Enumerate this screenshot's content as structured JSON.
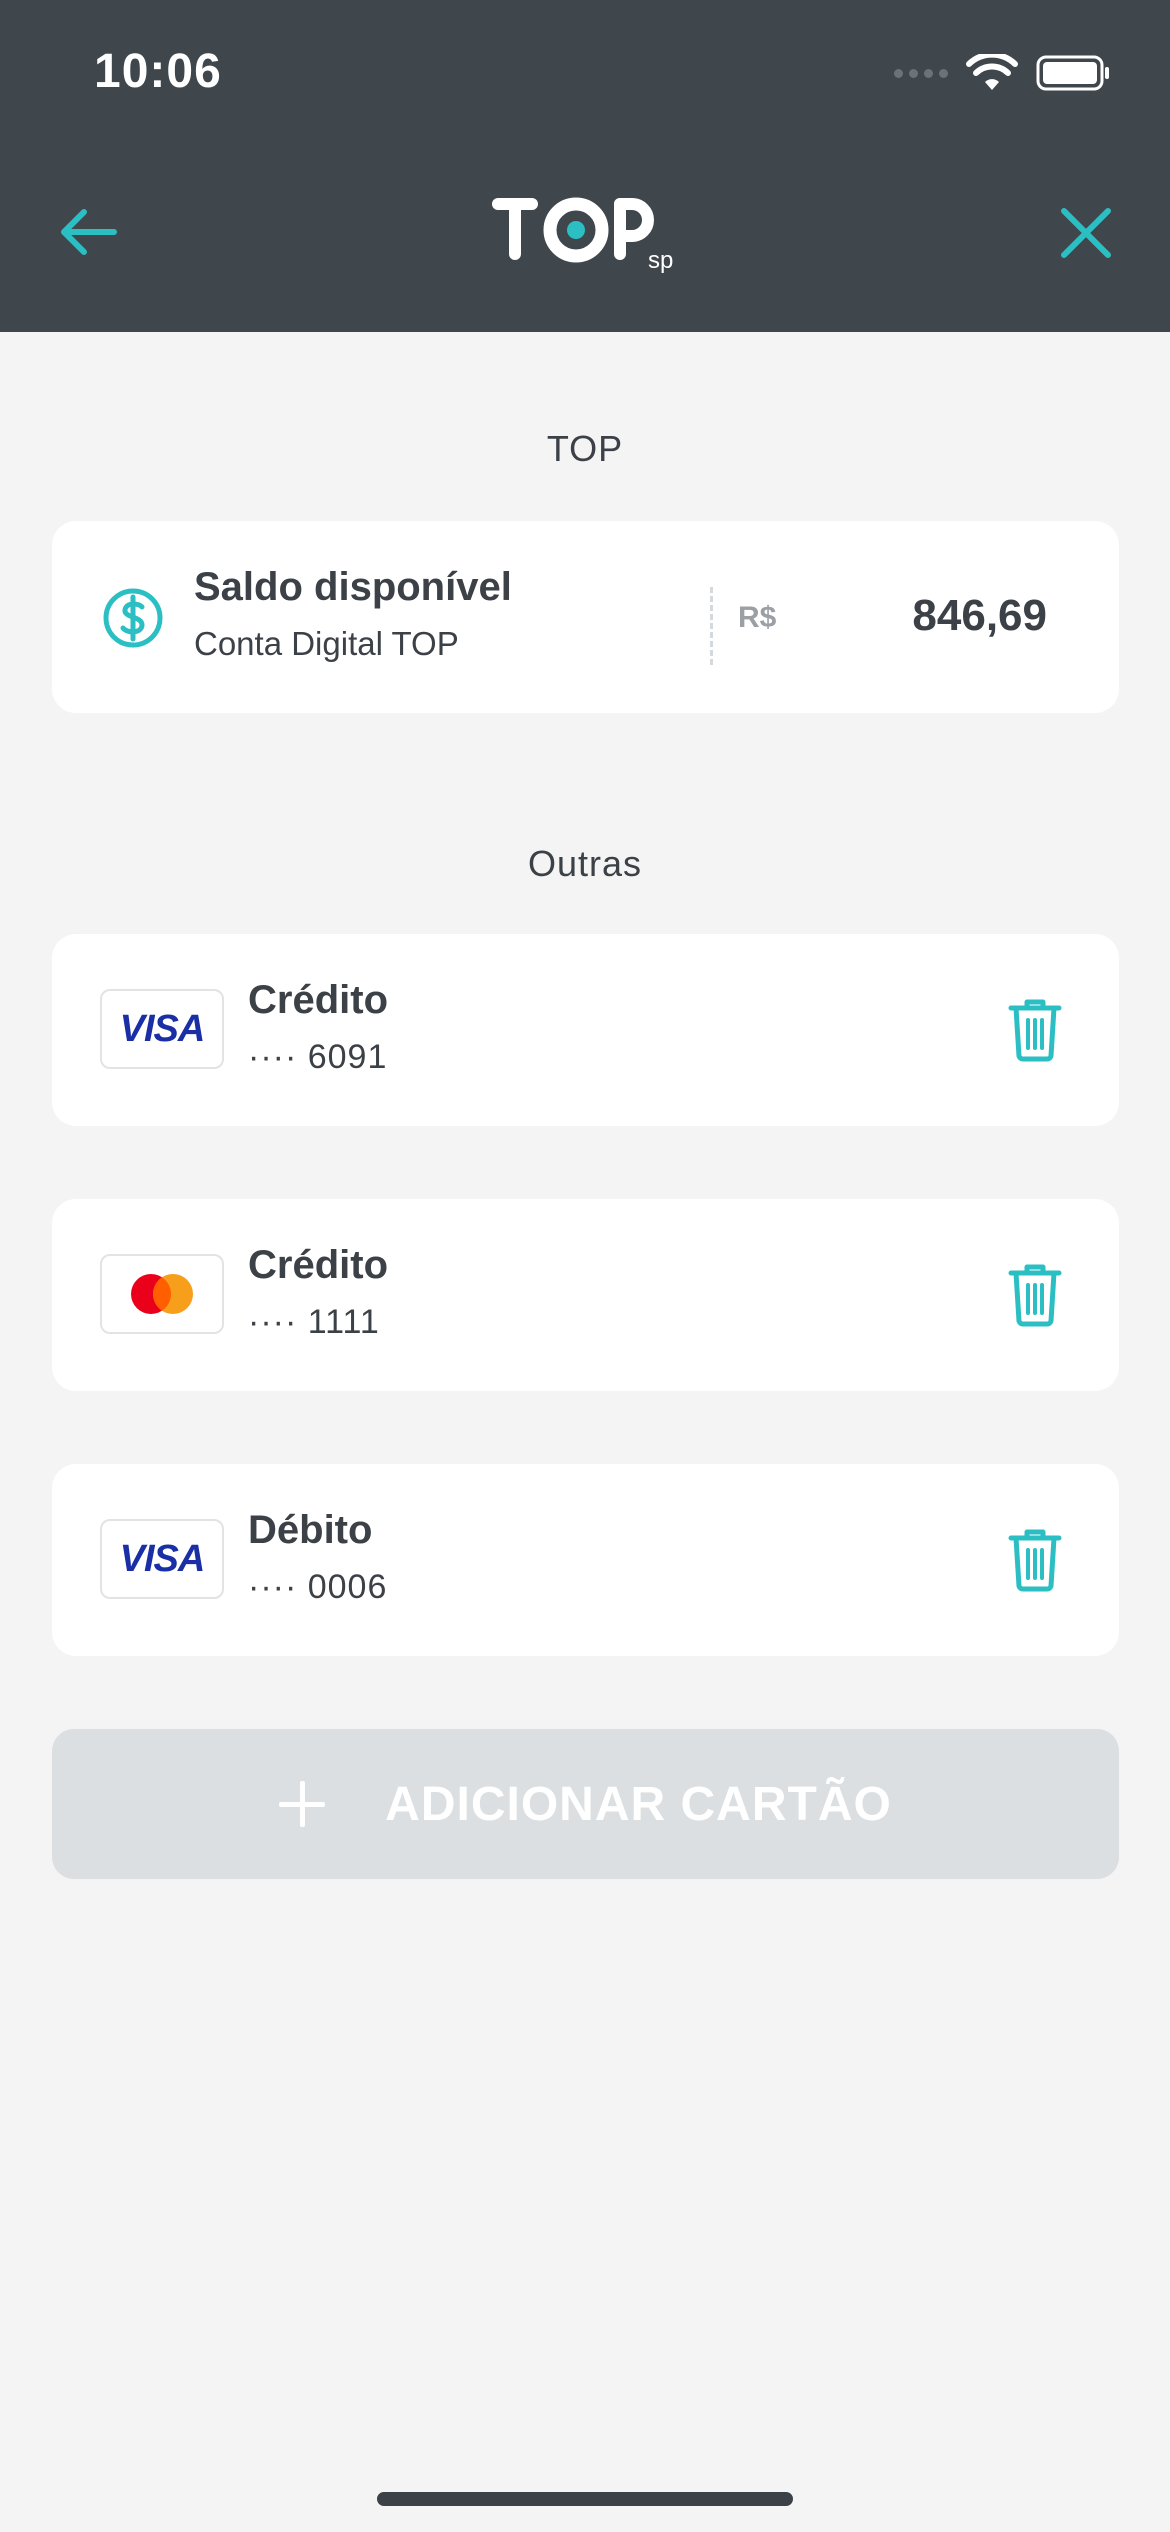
{
  "status_bar": {
    "time": "10:06"
  },
  "header": {
    "logo_text": "TOP",
    "logo_suffix": "sp"
  },
  "sections": {
    "top_title": "TOP",
    "others_title": "Outras"
  },
  "balance": {
    "title": "Saldo disponível",
    "subtitle": "Conta Digital TOP",
    "currency": "R$",
    "value": "846,69"
  },
  "cards": [
    {
      "brand": "VISA",
      "type": "Crédito",
      "number": "···· 6091"
    },
    {
      "brand": "mastercard",
      "type": "Crédito",
      "number": "···· 1111"
    },
    {
      "brand": "VISA",
      "type": "Débito",
      "number": "···· 0006"
    }
  ],
  "actions": {
    "add_card_label": "ADICIONAR CARTÃO"
  },
  "colors": {
    "header_bg": "#3f464c",
    "accent": "#2bbfc4",
    "page_bg": "#f4f4f4",
    "card_bg": "#ffffff",
    "button_bg": "#dbdfe1",
    "visa_blue": "#1a2fa6",
    "mc_red": "#eb001b",
    "mc_orange": "#f79e1b"
  }
}
